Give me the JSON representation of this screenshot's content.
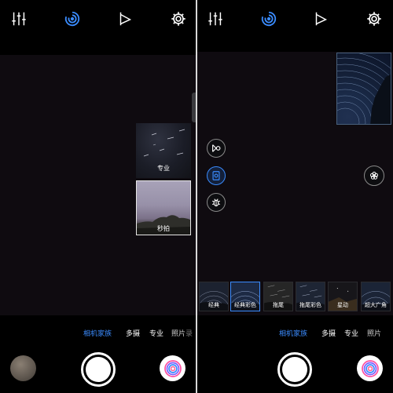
{
  "colors": {
    "accent": "#3b8cff",
    "background": "#000000",
    "viewfinder": "#0f0b10"
  },
  "left": {
    "topbar": {
      "icons": [
        "sliders-icon",
        "swirl-mode-icon",
        "flag-play-icon",
        "settings-gear-icon"
      ]
    },
    "thumbnails": [
      {
        "label": "专业"
      },
      {
        "label": "秒拍"
      }
    ],
    "modes": [
      {
        "label": "相机家族",
        "active": true
      },
      {
        "label": "多摄",
        "active": false
      },
      {
        "label": "专业",
        "active": false
      },
      {
        "label": "照片",
        "active": false
      },
      {
        "label": "录",
        "active": false
      }
    ],
    "bottom": {
      "gallery": "gallery-thumbnail",
      "shutter": "shutter-button",
      "family": "camera-family-icon"
    }
  },
  "right": {
    "topbar": {
      "icons": [
        "sliders-icon",
        "swirl-mode-icon",
        "flag-play-icon",
        "settings-gear-icon"
      ]
    },
    "side_controls": [
      "record-icon",
      "portrait-frame-icon",
      "bug-icon"
    ],
    "filters": [
      {
        "label": "经典",
        "selected": false
      },
      {
        "label": "经典彩色",
        "selected": true
      },
      {
        "label": "拖尾",
        "selected": false
      },
      {
        "label": "拖尾彩色",
        "selected": false
      },
      {
        "label": "星动",
        "selected": false
      },
      {
        "label": "超大广角",
        "selected": false
      }
    ],
    "modes": [
      {
        "label": "相机家族",
        "active": true
      },
      {
        "label": "多摄",
        "active": false
      },
      {
        "label": "专业",
        "active": false
      },
      {
        "label": "照片",
        "active": false
      }
    ],
    "bottom": {
      "shutter": "shutter-button",
      "family": "camera-family-icon"
    }
  }
}
